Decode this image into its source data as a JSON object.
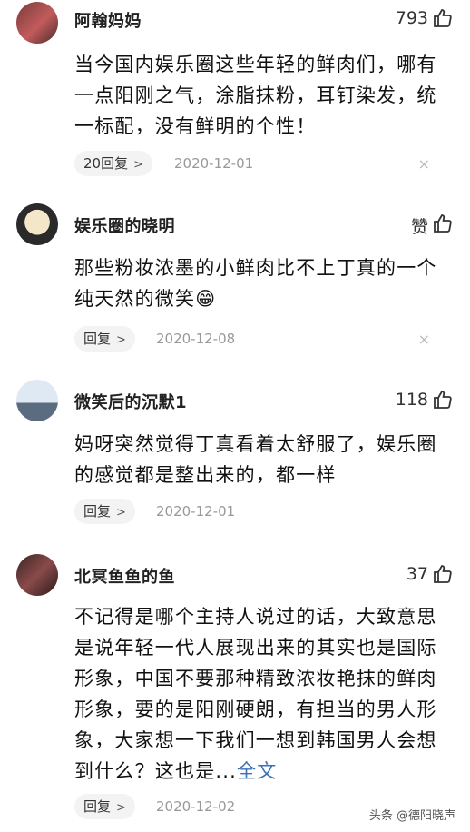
{
  "comments": [
    {
      "username": "阿翰妈妈",
      "likes": "793",
      "text": "当今国内娱乐圈这些年轻的鲜肉们，哪有一点阳刚之气，涂脂抹粉，耳钉染发，统一标配，没有鲜明的个性！",
      "reply_label": "20回复",
      "date": "2020-12-01"
    },
    {
      "username": "娱乐圈的晓明",
      "likes": "赞",
      "text": "那些粉妆浓墨的小鲜肉比不上丁真的一个纯天然的微笑",
      "emoji": "😁",
      "reply_label": "回复",
      "date": "2020-12-08"
    },
    {
      "username": "微笑后的沉默1",
      "likes": "118",
      "text": "妈呀突然觉得丁真看着太舒服了，娱乐圈的感觉都是整出来的，都一样",
      "reply_label": "回复",
      "date": "2020-12-01"
    },
    {
      "username": "北冥鱼鱼的鱼",
      "likes": "37",
      "text": "不记得是哪个主持人说过的话，大致意思是说年轻一代人展现出来的其实也是国际形象，中国不要那种精致浓妆艳抹的鲜肉形象，要的是阳刚硬朗，有担当的男人形象，大家想一下我们一想到韩国男人会想到什么？这也是...",
      "more_label": "全文",
      "reply_label": "回复",
      "date": "2020-12-02"
    }
  ],
  "icons": {
    "like": "thumbs-up-icon",
    "reply_chevron": "chevron-right-icon",
    "dismiss": "close-icon"
  },
  "watermark": "头条 @德阳晓声"
}
